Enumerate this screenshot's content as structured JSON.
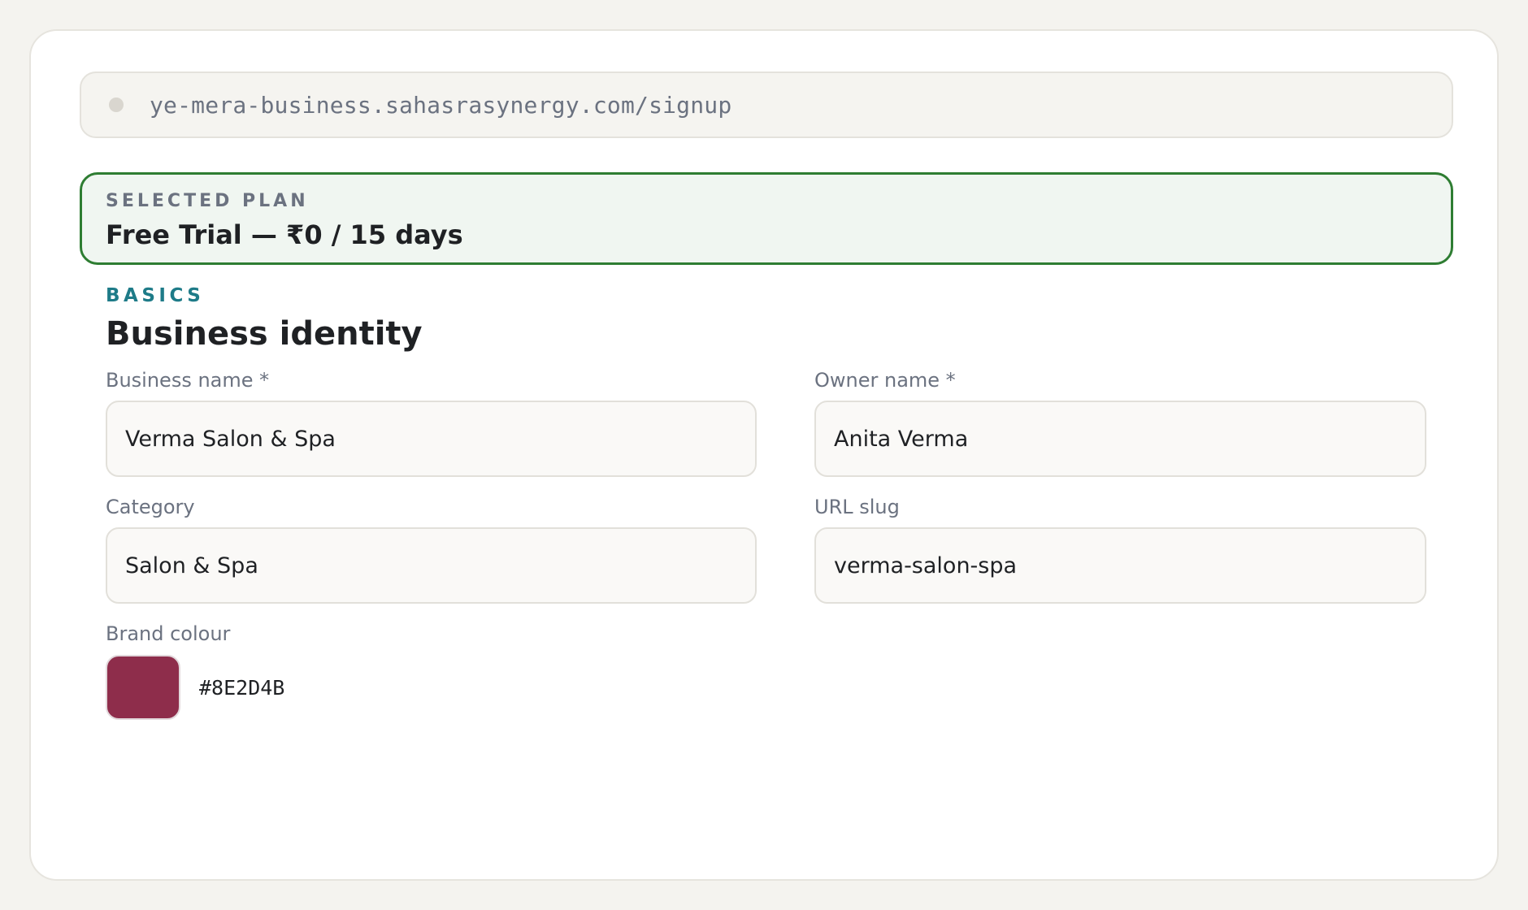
{
  "browser": {
    "url": "ye-mera-business.sahasrasynergy.com/signup",
    "status_icon": "status-dot-icon"
  },
  "plan": {
    "kicker": "SELECTED PLAN",
    "title": "Free Trial — ₹0 / 15 days"
  },
  "section": {
    "kicker": "BASICS",
    "title": "Business identity"
  },
  "fields": {
    "business_name": {
      "label": "Business name *",
      "value": "Verma Salon & Spa"
    },
    "owner_name": {
      "label": "Owner name *",
      "value": "Anita Verma"
    },
    "category": {
      "label": "Category",
      "value": "Salon & Spa"
    },
    "url_slug": {
      "label": "URL slug",
      "value": "verma-salon-spa"
    },
    "brand_colour": {
      "label": "Brand colour",
      "value": "#8E2D4B"
    }
  },
  "colors": {
    "plan_border": "#2e7d32",
    "section_accent": "#1e7b88",
    "brand_swatch": "#8E2D4B"
  }
}
